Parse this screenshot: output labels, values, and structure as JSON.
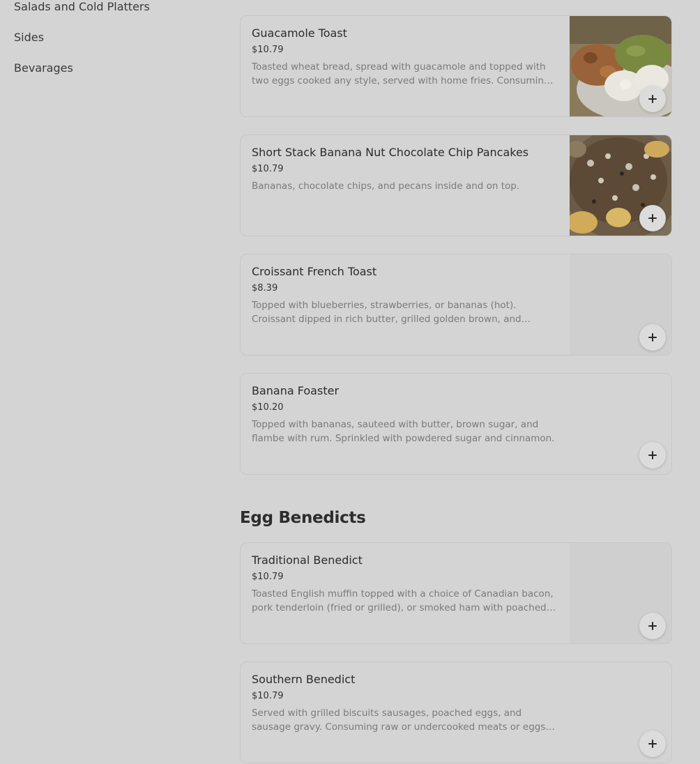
{
  "sidebar": {
    "items": [
      {
        "label": "Salads and Cold Platters"
      },
      {
        "label": "Sides"
      },
      {
        "label": "Bevarages"
      }
    ]
  },
  "section": {
    "title": "Egg Benedicts"
  },
  "items": [
    {
      "name": "Guacamole Toast",
      "price": "$10.79",
      "description": "Toasted wheat bread, spread with guacamole and topped with two eggs cooked any style, served with home fries. Consuming raw or undercooked meats or eggs may increase your risk of foodborne illness.",
      "image": "guacamole-toast-photo"
    },
    {
      "name": "Short Stack Banana Nut Chocolate Chip Pancakes",
      "price": "$10.79",
      "description": "Bananas, chocolate chips, and pecans inside and on top.",
      "image": "pancakes-photo"
    },
    {
      "name": "Croissant French Toast",
      "price": "$8.39",
      "description": "Topped with blueberries, strawberries, or bananas (hot). Croissant dipped in rich butter, grilled golden brown, and sprinkled with powdered sugar.",
      "image": ""
    },
    {
      "name": "Banana Foaster",
      "price": "$10.20",
      "description": "Topped with bananas, sauteed with butter, brown sugar, and flambe with rum. Sprinkled with powdered sugar and cinnamon.",
      "image": ""
    },
    {
      "name": "Traditional Benedict",
      "price": "$10.79",
      "description": "Toasted English muffin topped with a choice of Canadian bacon, pork tenderloin (fried or grilled), or smoked ham with poached eggs and hollandaise sauce.",
      "image": ""
    },
    {
      "name": "Southern Benedict",
      "price": "$10.79",
      "description": "Served with grilled biscuits sausages, poached eggs, and sausage gravy. Consuming raw or undercooked meats or eggs may increase your risk of foodborne illness.",
      "image": ""
    }
  ],
  "icons": {
    "add": "plus-icon"
  },
  "colors": {
    "overlay_bg": "#d4d4d4",
    "card_border": "#c6c6c6"
  }
}
